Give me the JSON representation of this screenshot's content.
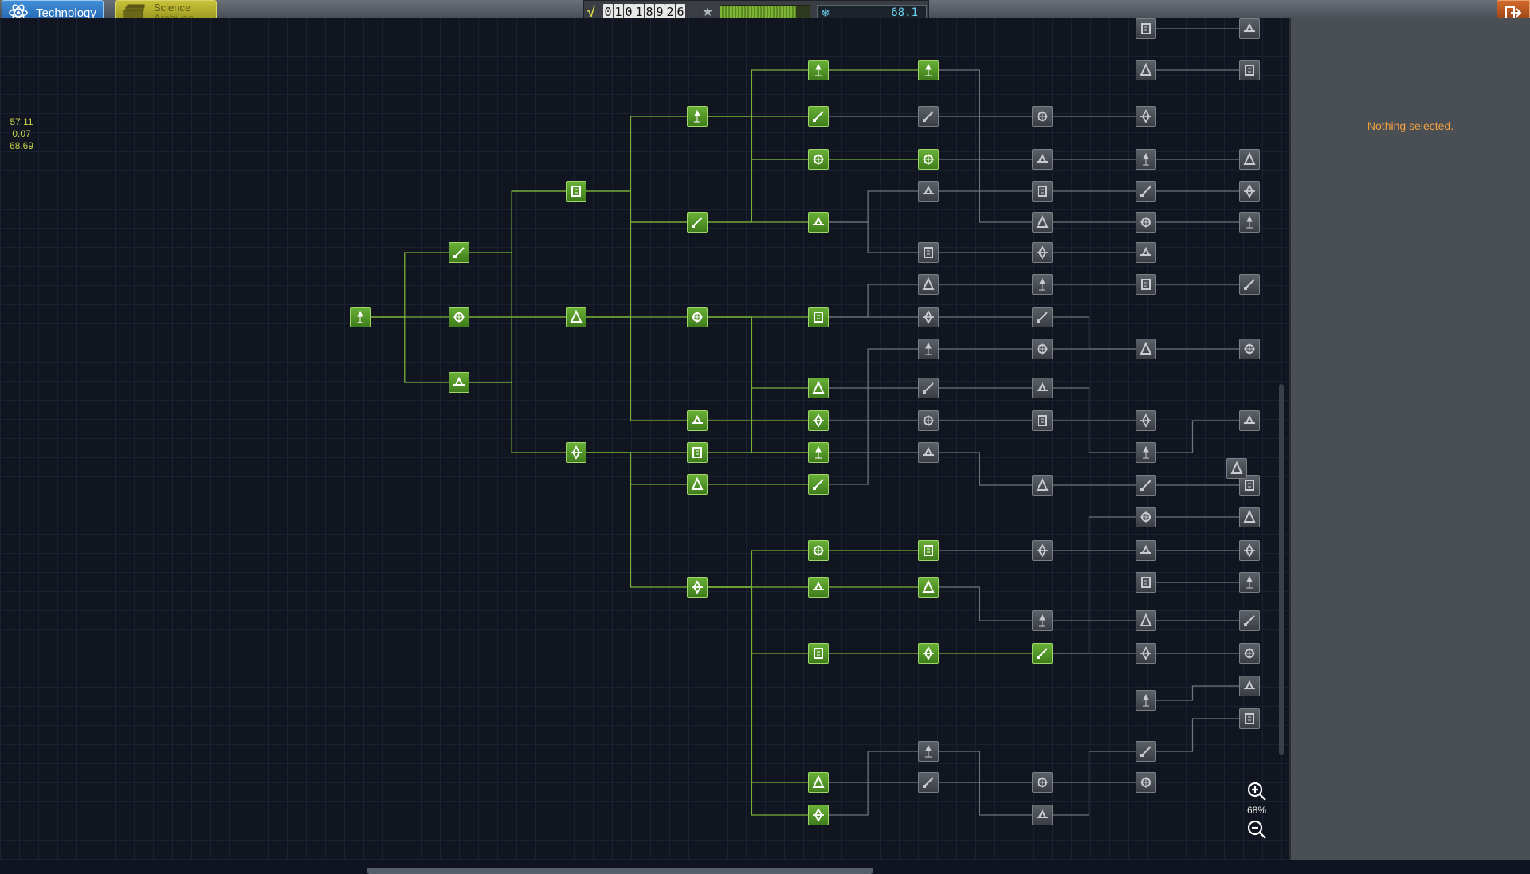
{
  "tabs": {
    "technology": "Technology",
    "science_archives_line1": "Science",
    "science_archives_line2": "Archives"
  },
  "resources": {
    "funds_digits": [
      "0",
      "1",
      "0",
      "1",
      "8",
      "9",
      "2",
      "6"
    ],
    "reputation_fraction": 0.85,
    "science": "68.1"
  },
  "debug": {
    "line1": "57.11",
    "line2": "0.07",
    "line3": "68.69"
  },
  "side_panel": {
    "status": "Nothing selected."
  },
  "zoom": {
    "level": "68%"
  },
  "colors": {
    "researched_node": "#5a9a2a",
    "locked_node": "#4a4f56",
    "researched_link": "#7ab03a",
    "locked_link": "#6f747a",
    "status_text": "#f0a040"
  }
}
